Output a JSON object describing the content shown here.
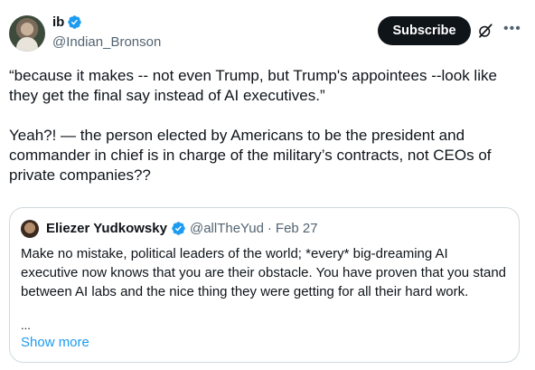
{
  "author": {
    "name": "ib",
    "handle": "@Indian_Bronson"
  },
  "actions": {
    "subscribe_label": "Subscribe",
    "grok_icon": "grok-icon",
    "more_icon": "more-icon"
  },
  "tweet": {
    "paragraph1": "“because it makes -- not even Trump, but Trump's appointees --look like they get the final say instead of AI executives.”",
    "paragraph2": "Yeah?! — the person elected by Americans to be the president and commander in chief is in charge of the military’s contracts, not CEOs of private companies??"
  },
  "quote": {
    "name": "Eliezer Yudkowsky",
    "handle": "@allTheYud",
    "separator": "·",
    "date": "Feb 27",
    "text": "Make no mistake, political leaders of the world; *every* big-dreaming AI executive now knows that you are their obstacle.  You have proven that you stand between AI labs and the nice thing they were getting for all their hard work.",
    "ellipsis": "...",
    "show_more": "Show more"
  },
  "colors": {
    "verified": "#1d9bf0",
    "link": "#1d9bf0",
    "secondary_text": "#536471",
    "border": "#cfd9de"
  }
}
